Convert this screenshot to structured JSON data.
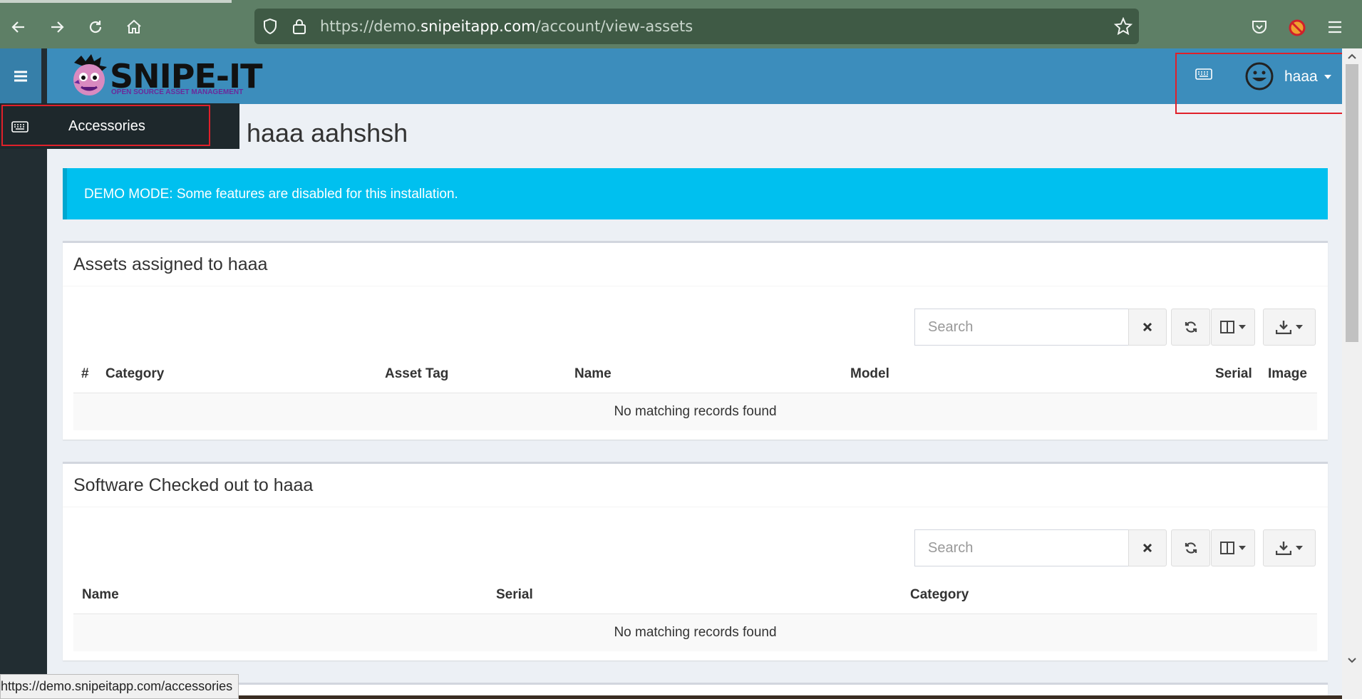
{
  "browser": {
    "url_prefix": "https://demo.",
    "url_domain": "snipeitapp.com",
    "url_path": "/account/view-assets",
    "status_url": "https://demo.snipeitapp.com/accessories"
  },
  "app": {
    "logo_text": "SNIPE-IT",
    "logo_subtitle": "OPEN SOURCE ASSET MANAGEMENT",
    "username": "haaa",
    "flyout_item": "Accessories",
    "page_title": "haaa aahshsh",
    "alert_text": "DEMO MODE: Some features are disabled for this installation."
  },
  "assets_box": {
    "title": "Assets assigned to haaa",
    "search_placeholder": "Search",
    "columns": [
      "#",
      "Category",
      "Asset Tag",
      "Name",
      "Model",
      "Serial",
      "Image"
    ],
    "empty_text": "No matching records found"
  },
  "software_box": {
    "title": "Software Checked out to haaa",
    "search_placeholder": "Search",
    "columns": [
      "Name",
      "Serial",
      "Category"
    ],
    "empty_text": "No matching records found"
  },
  "colors": {
    "header": "#3c8dbc",
    "sidebar": "#222d32",
    "alert": "#00c0ef",
    "highlight": "#e0202a"
  }
}
